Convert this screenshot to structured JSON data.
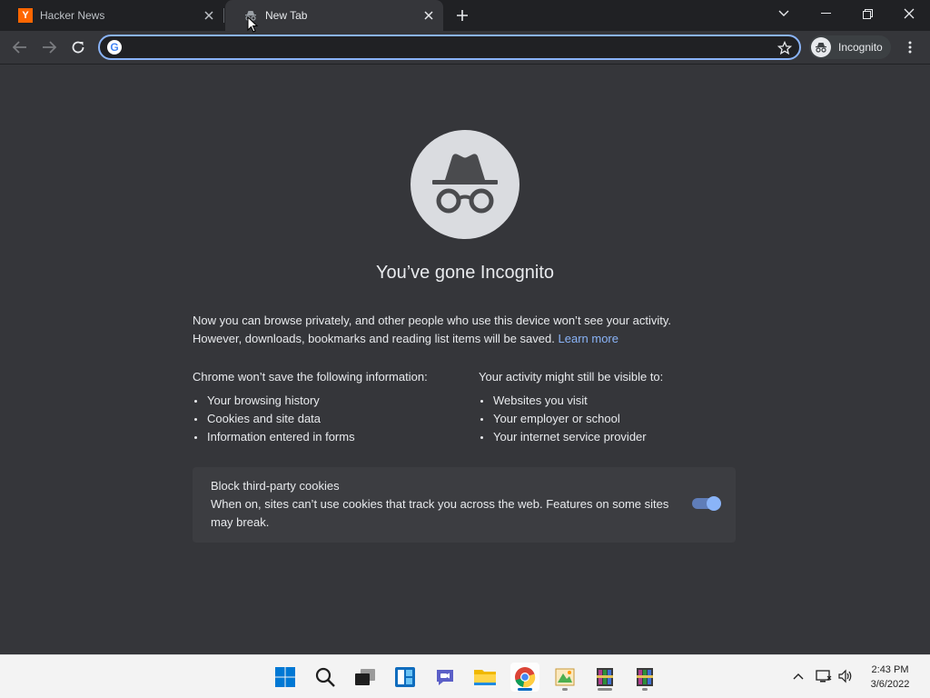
{
  "tabs": [
    {
      "title": "Hacker News",
      "favicon": "hacker-news-icon",
      "active": false
    },
    {
      "title": "New Tab",
      "favicon": "incognito-icon",
      "active": true
    }
  ],
  "toolbar": {
    "omnibox_value": "",
    "profile_label": "Incognito"
  },
  "content": {
    "headline": "You’ve gone Incognito",
    "intro_line1": "Now you can browse privately, and other people who use this device won’t see your activity.",
    "intro_line2": "However, downloads, bookmarks and reading list items will be saved.",
    "learn_more": "Learn more",
    "left_heading": "Chrome won’t save the following information:",
    "left_items": [
      "Your browsing history",
      "Cookies and site data",
      "Information entered in forms"
    ],
    "right_heading": "Your activity might still be visible to:",
    "right_items": [
      "Websites you visit",
      "Your employer or school",
      "Your internet service provider"
    ],
    "cookie_title": "Block third-party cookies",
    "cookie_desc": "When on, sites can’t use cookies that track you across the web. Features on some sites may break.",
    "cookie_toggle_on": true
  },
  "taskbar": {
    "apps": [
      "start-icon",
      "search-icon",
      "task-view-icon",
      "widgets-icon",
      "chat-icon",
      "file-explorer-icon",
      "chrome-icon",
      "paint-icon",
      "winrar-icon",
      "winrar-icon"
    ],
    "time": "2:43 PM",
    "date": "3/6/2022"
  },
  "colors": {
    "accent": "#8ab4f8",
    "page_bg": "#35363a",
    "tabstrip_bg": "#202124",
    "hn_orange": "#ff6600"
  }
}
